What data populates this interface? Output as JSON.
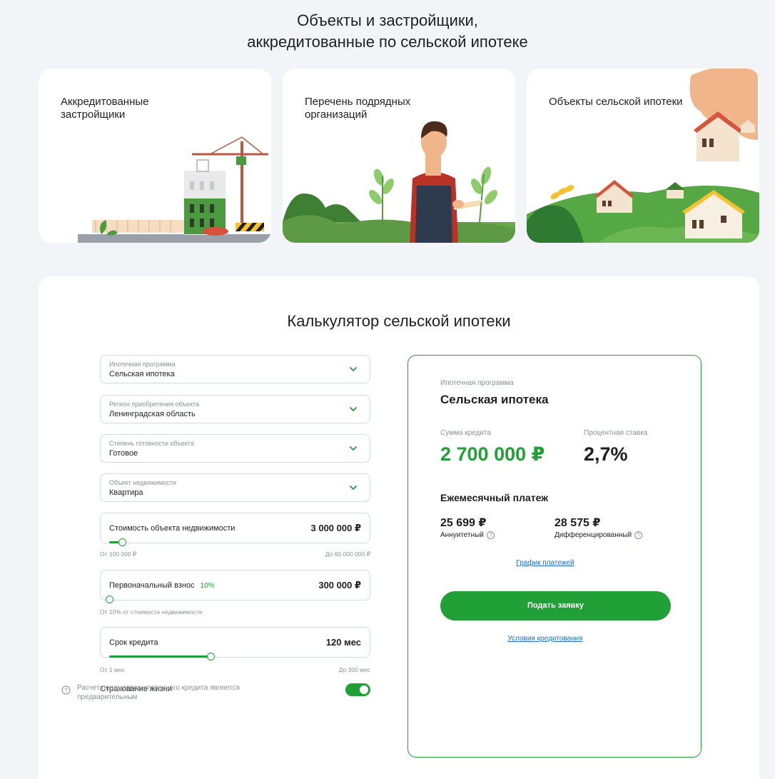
{
  "page": {
    "title_line1": "Объекты и застройщики,",
    "title_line2": "аккредитованные по сельской ипотеке"
  },
  "cards": [
    {
      "title": "Аккредитованные застройщики"
    },
    {
      "title": "Перечень подрядных организаций"
    },
    {
      "title": "Объекты сельской ипотеки"
    }
  ],
  "calculator": {
    "title": "Калькулятор сельской ипотеки",
    "selects": [
      {
        "label": "Ипотечная программа",
        "value": "Сельская ипотека"
      },
      {
        "label": "Регион приобретения объекта",
        "value": "Ленинградская область"
      },
      {
        "label": "Степень готовности объекта",
        "value": "Готовое"
      },
      {
        "label": "Объект недвижимости",
        "value": "Квартира"
      }
    ],
    "sliders": {
      "price": {
        "label": "Стоимость объекта недвижимости",
        "value": "3 000 000 ₽",
        "min_hint": "От 100 000 ₽",
        "max_hint": "До 60 000 000 ₽",
        "fill": 0.05
      },
      "down": {
        "label": "Первоначальный взнос",
        "percent": "10%",
        "value": "300 000 ₽",
        "min_hint": "От 10% от стоимости недвижимости",
        "fill": 0.0
      },
      "term": {
        "label": "Срок кредита",
        "value": "120 мес",
        "min_hint": "От 1 мес",
        "max_hint": "До 300 мес",
        "fill": 0.4
      }
    },
    "insurance": {
      "label": "Страхование жизни",
      "on": true
    },
    "note": "Расчет параметров ипотечного кредита является предварительным"
  },
  "result": {
    "program_label": "Ипотечная программа",
    "program_value": "Сельская ипотека",
    "amount_label": "Сумма кредита",
    "amount_value": "2 700 000 ₽",
    "rate_label": "Процентная ставка",
    "rate_value": "2,7%",
    "monthly_title": "Ежемесячный платеж",
    "annuity_value": "25 699 ₽",
    "annuity_label": "Аннуитетный",
    "diff_value": "28 575 ₽",
    "diff_label": "Дифференцированный",
    "schedule_link": "График платежей",
    "apply_button": "Подать заявку",
    "terms_link": "Условия кредитования"
  },
  "colors": {
    "accent": "#21a038",
    "link": "#1e6bd6",
    "background": "#f2f4f7"
  }
}
